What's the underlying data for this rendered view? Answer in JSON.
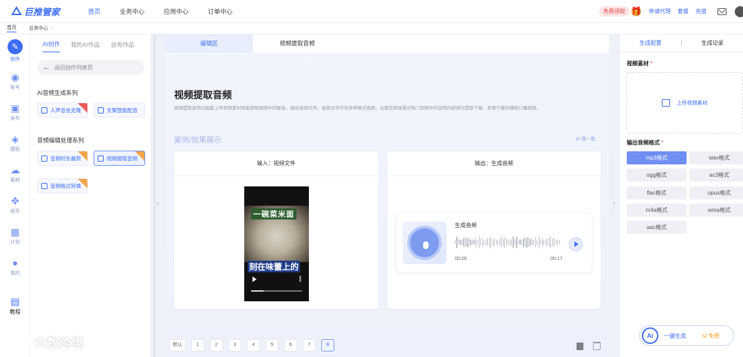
{
  "brand": {
    "name": "巨推管家"
  },
  "nav": [
    "首页",
    "业务中心",
    "应用中心",
    "订单中心"
  ],
  "top_right": {
    "free_trial": "免费领取",
    "links": [
      "申请代理",
      "套餐",
      "充值"
    ]
  },
  "breadcrumb": [
    "首页",
    "业务中心"
  ],
  "left_nav": [
    {
      "label": "创作",
      "icon": "pencil-icon"
    },
    {
      "label": "账号",
      "icon": "user-icon"
    },
    {
      "label": "发布",
      "icon": "publish-icon"
    },
    {
      "label": "模板",
      "icon": "layers-icon"
    },
    {
      "label": "素材",
      "icon": "cloud-icon"
    },
    {
      "label": "组件",
      "icon": "puzzle-icon"
    },
    {
      "label": "计划",
      "icon": "calendar-icon"
    },
    {
      "label": "我的",
      "icon": "person-icon"
    },
    {
      "label": "教程",
      "icon": "book-icon"
    }
  ],
  "panel": {
    "tabs": [
      "AI创作",
      "我的AI作品",
      "自有作品"
    ],
    "back": "返回创作列表页",
    "section1": "AI音频生成系列",
    "section1_tools": [
      "人声音色克隆",
      "文案智能配音"
    ],
    "section2": "音频编辑处理系列",
    "section2_tools": [
      "音频时长裁剪",
      "视频提取音频",
      "音频格式转换"
    ]
  },
  "main": {
    "tabs": [
      "编辑区",
      "视频提取音频"
    ],
    "title": "视频提取音频",
    "desc": "视频提取音频功能能上传视频素材智能获取视频中的配音，输出音频文件，音频文件可供多种格式选择。主要应用场景对热门视频中的音频内容进行提取下载，多用于模仿爆款口播视频。",
    "case_title": "案例/效果展示",
    "swap": "换一批",
    "input_title": "输入：视频文件",
    "output_title": "输出：生成音频",
    "video_caption_top": "一碗菜米面",
    "video_caption_bottom": "刻在味蕾上的",
    "audio_title": "生成音频",
    "time_start": "00:00",
    "time_end": "00:17",
    "pager": [
      "默认",
      "1",
      "2",
      "3",
      "4",
      "5",
      "6",
      "7",
      "8"
    ],
    "pager_active": "8"
  },
  "right": {
    "tabs": [
      "生成配置",
      "生成记录"
    ],
    "material_label": "视频素材",
    "upload": "上传视频素材",
    "format_label": "输出音频格式",
    "formats": [
      "mp3格式",
      "wav格式",
      "ogg格式",
      "ac3格式",
      "flac格式",
      "opus格式",
      "m4a格式",
      "wma格式",
      "aac格式"
    ],
    "selected_format": "mp3格式",
    "generate": "一键生成",
    "free": "免费",
    "ai_badge": "Ai"
  },
  "watermark": "大数跨境",
  "colors": {
    "accent": "#3b6cf6",
    "selected_format": "#6f8ff3",
    "badge_orange": "#f2a64b",
    "badge_red": "#ef5a5a"
  }
}
